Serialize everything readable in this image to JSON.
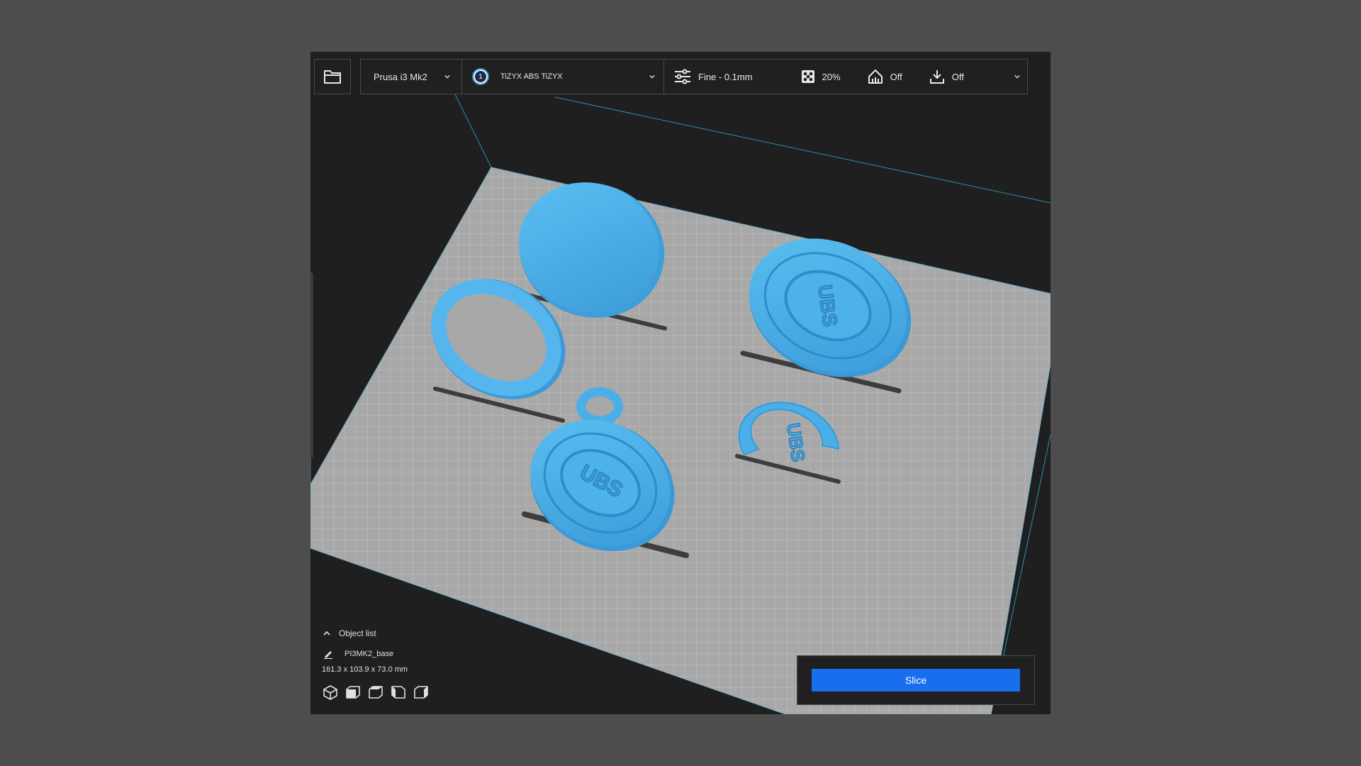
{
  "toolbar": {
    "printer": "Prusa i3 Mk2",
    "material_badge": "1",
    "material": "TiZYX ABS TiZYX",
    "profile": "Fine - 0.1mm",
    "infill": "20%",
    "support": "Off",
    "adhesion": "Off"
  },
  "object_list": {
    "title": "Object list",
    "active_object": "PI3MK2_base",
    "dimensions": "161.3 x 103.9 x 73.0 mm"
  },
  "view_buttons": [
    "3d-view",
    "front-view",
    "top-view",
    "left-view",
    "right-view"
  ],
  "slice": {
    "label": "Slice"
  },
  "colors": {
    "accent": "#196ef0",
    "model": "#4aaee8",
    "bed": "#a9a9a9",
    "background": "#1f1f1f"
  }
}
